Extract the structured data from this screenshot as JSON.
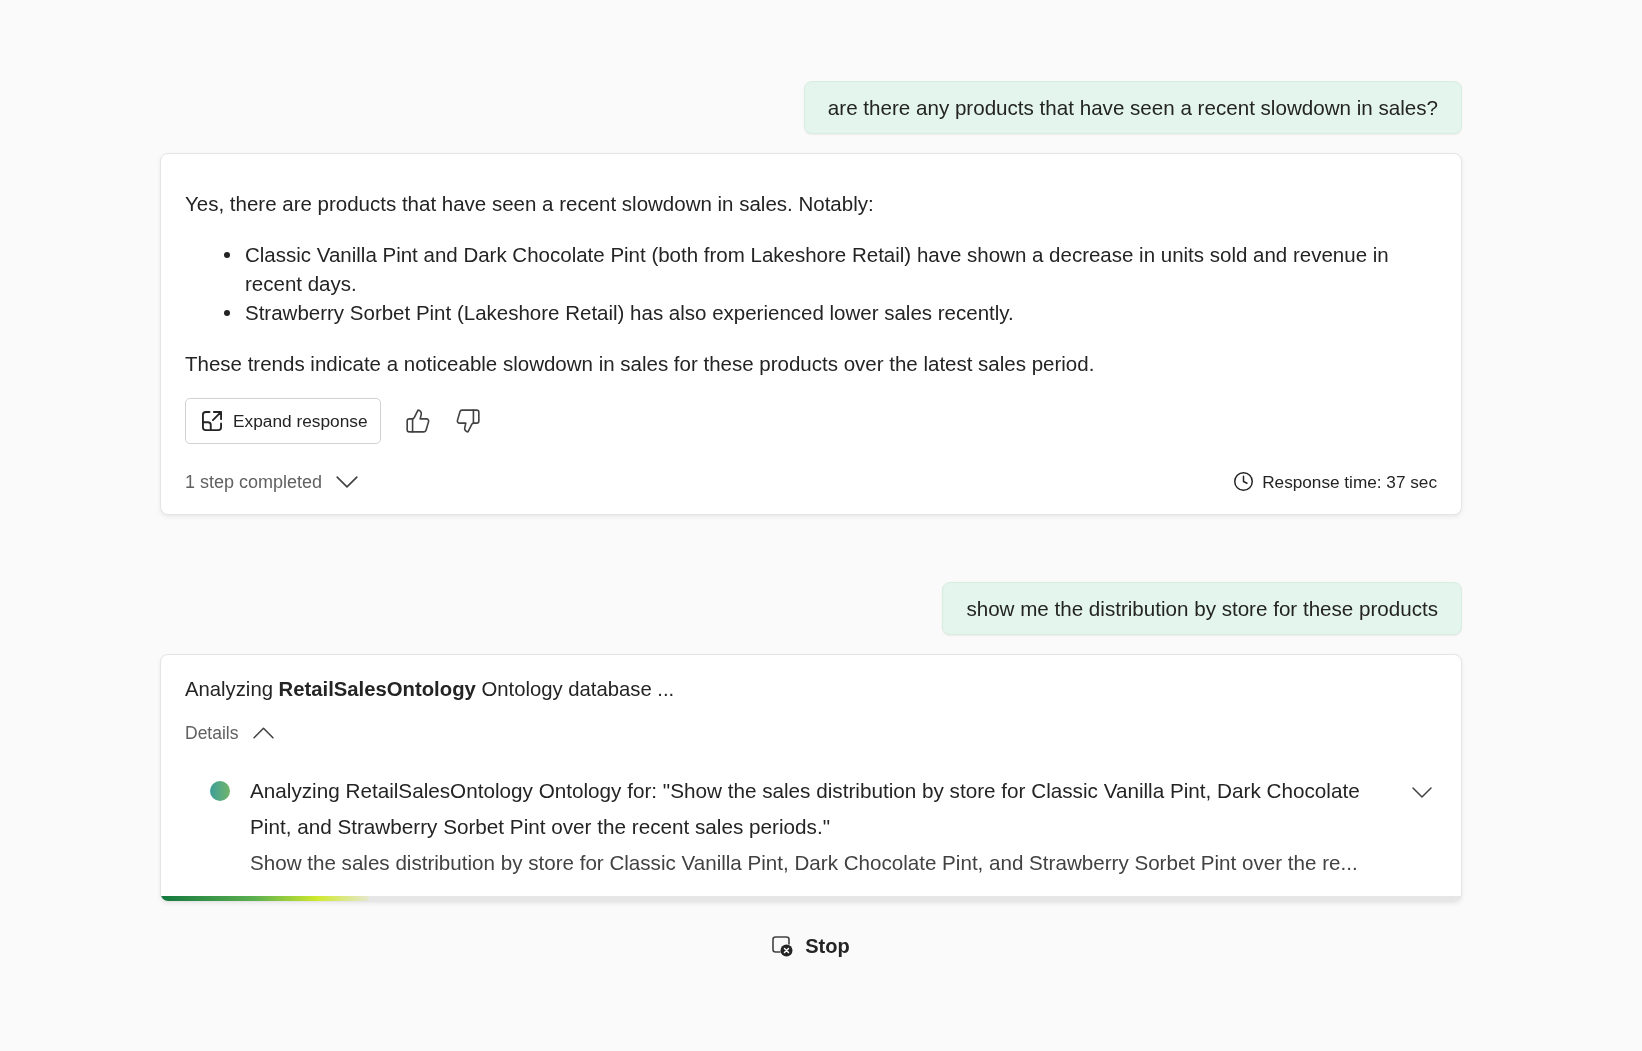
{
  "conversation": [
    {
      "kind": "user",
      "text": "are there any products that have seen a recent slowdown in sales?"
    },
    {
      "kind": "response",
      "intro": "Yes, there are products that have seen a recent slowdown in sales. Notably:",
      "bullets": [
        "Classic Vanilla Pint and Dark Chocolate Pint (both from Lakeshore Retail) have shown a decrease in units sold and revenue in recent days.",
        "Strawberry Sorbet Pint (Lakeshore Retail) has also experienced lower sales recently."
      ],
      "summary": "These trends indicate a noticeable slowdown in sales for these products over the latest sales period.",
      "expand_button": "Expand response",
      "steps_toggle": {
        "label": "1 step completed",
        "expanded": false
      },
      "response_time": "Response time: 37 sec"
    },
    {
      "kind": "user",
      "text": "show me the distribution by store for these products"
    },
    {
      "kind": "progress",
      "status": "Analyzing **RetailSalesOntology** Ontology database ...",
      "details": {
        "label": "Details",
        "expanded": true
      },
      "steps": [
        {
          "title": "Analyzing RetailSalesOntology Ontology for: \"Show the sales distribution by store for Classic Vanilla Pint, Dark Chocolate Pint, and Strawberry Sorbet Pint over the recent sales periods.\"",
          "subtitle": "Show the sales distribution by store for Classic Vanilla Pint, Dark Chocolate Pint, and Strawberry Sorbet Pint over the re...",
          "expanded": false
        }
      ],
      "level": 0.16
    }
  ],
  "stop_button": "Stop"
}
